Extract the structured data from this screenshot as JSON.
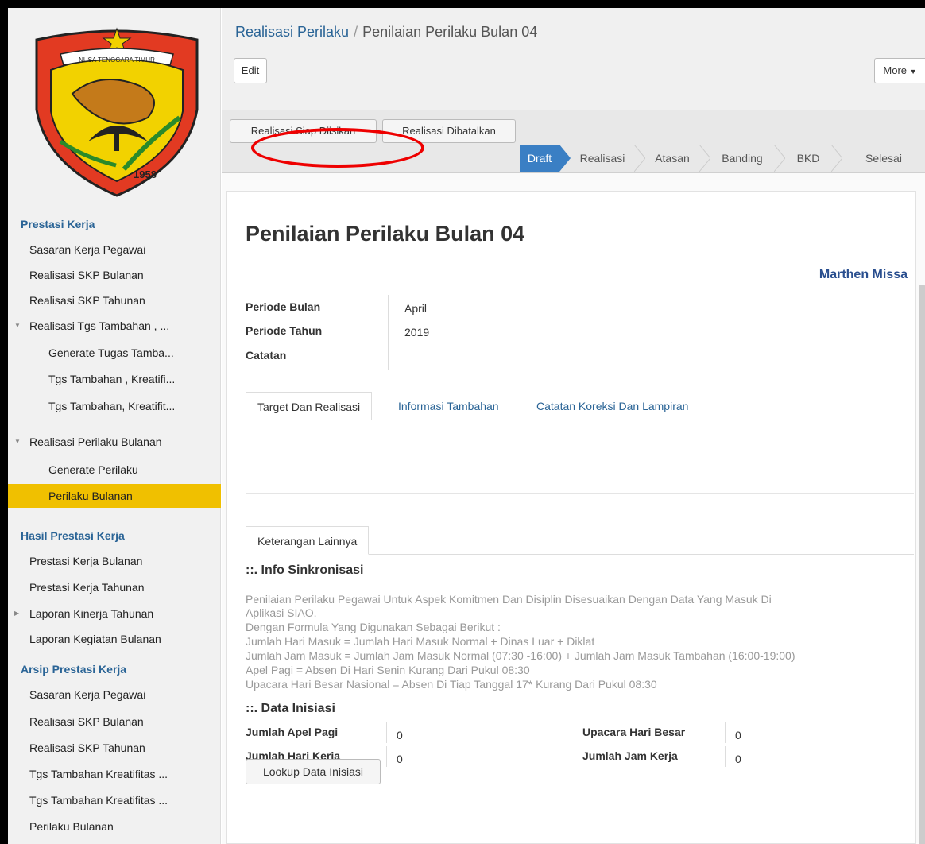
{
  "sidebar": {
    "sections": [
      {
        "title": "Prestasi Kerja"
      },
      {
        "title": "Hasil Prestasi Kerja"
      },
      {
        "title": "Arsip Prestasi Kerja"
      }
    ],
    "items": [
      {
        "label": "Sasaran Kerja Pegawai"
      },
      {
        "label": "Realisasi SKP Bulanan"
      },
      {
        "label": "Realisasi SKP Tahunan"
      },
      {
        "label": "Realisasi Tgs Tambahan , ..."
      },
      {
        "label": "Generate Tugas Tamba..."
      },
      {
        "label": "Tgs Tambahan , Kreatifi..."
      },
      {
        "label": "Tgs Tambahan, Kreatifit..."
      },
      {
        "label": "Realisasi Perilaku Bulanan"
      },
      {
        "label": "Generate Perilaku"
      },
      {
        "label": "Perilaku Bulanan"
      },
      {
        "label": "Prestasi Kerja Bulanan"
      },
      {
        "label": "Prestasi Kerja Tahunan"
      },
      {
        "label": "Laporan Kinerja Tahunan"
      },
      {
        "label": "Laporan Kegiatan Bulanan"
      },
      {
        "label": "Sasaran Kerja Pegawai"
      },
      {
        "label": "Realisasi SKP Bulanan"
      },
      {
        "label": "Realisasi SKP Tahunan"
      },
      {
        "label": "Tgs Tambahan Kreatifitas ..."
      },
      {
        "label": "Tgs Tambahan Kreatifitas ..."
      },
      {
        "label": "Perilaku Bulanan"
      }
    ],
    "logo": {
      "banner": "NUSA TENGGARA TIMUR",
      "year": "1958"
    }
  },
  "breadcrumb": {
    "parent": "Realisasi Perilaku",
    "separator": "/",
    "current": "Penilaian Perilaku Bulan 04"
  },
  "toolbar": {
    "edit": "Edit",
    "more": "More"
  },
  "status": {
    "btn_siap": "Realisasi Siap Diisikan",
    "btn_batal": "Realisasi Dibatalkan",
    "stages": [
      "Draft",
      "Realisasi",
      "Atasan",
      "Banding",
      "BKD",
      "Selesai"
    ],
    "active_stage": "Draft"
  },
  "form": {
    "title": "Penilaian Perilaku Bulan 04",
    "user": "Marthen Missa",
    "fields": [
      {
        "label": "Periode Bulan",
        "value": "April"
      },
      {
        "label": "Periode Tahun",
        "value": "2019"
      },
      {
        "label": "Catatan",
        "value": ""
      }
    ],
    "tabs": [
      "Target Dan Realisasi",
      "Informasi Tambahan",
      "Catatan Koreksi Dan Lampiran"
    ],
    "tab2": "Keterangan Lainnya",
    "info_title": "::. Info Sinkronisasi",
    "info_lines": [
      "Penilaian Perilaku Pegawai Untuk Aspek Komitmen Dan Disiplin Disesuaikan Dengan Data Yang Masuk Di",
      "Aplikasi SIAO.",
      "Dengan Formula Yang Digunakan Sebagai Berikut :",
      "Jumlah Hari Masuk = Jumlah Hari Masuk Normal + Dinas Luar + Diklat",
      "Jumlah Jam Masuk = Jumlah Jam Masuk Normal (07:30 -16:00) + Jumlah Jam Masuk Tambahan (16:00-19:00)",
      "Apel Pagi = Absen Di Hari Senin Kurang Dari Pukul 08:30",
      "Upacara Hari Besar Nasional = Absen Di Tiap Tanggal 17* Kurang Dari Pukul 08:30"
    ],
    "data_title": "::. Data Inisiasi",
    "data": [
      {
        "label": "Jumlah Apel Pagi",
        "value": "0"
      },
      {
        "label": "Upacara Hari Besar",
        "value": "0"
      },
      {
        "label": "Jumlah Hari Kerja",
        "value": "0"
      },
      {
        "label": "Jumlah Jam Kerja",
        "value": "0"
      }
    ],
    "lookup": "Lookup Data Inisiasi"
  },
  "colors": {
    "accent": "#3a7fc4",
    "link": "#2a6496",
    "active_menu": "#f0c000",
    "annotation": "#e00000"
  }
}
